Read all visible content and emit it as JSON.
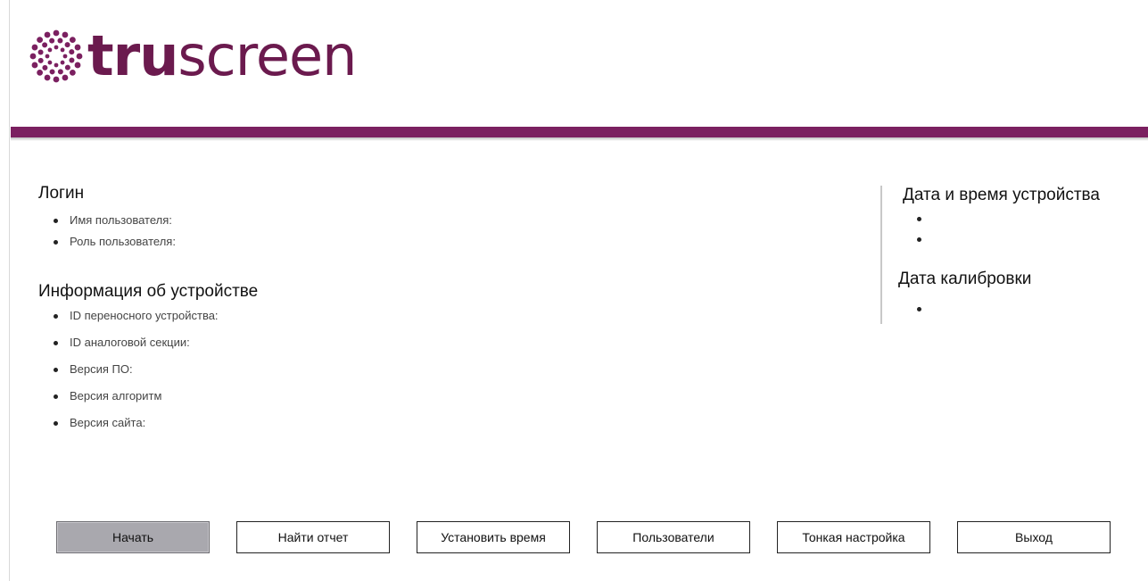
{
  "brand": {
    "logo_text_bold": "tru",
    "logo_text_thin": "screen",
    "accent_color": "#7b2060"
  },
  "login": {
    "title": "Логин",
    "items": [
      {
        "label": "Имя пользователя:"
      },
      {
        "label": "Роль пользователя:"
      }
    ]
  },
  "device_info": {
    "title": "Информация об устройстве",
    "items": [
      {
        "label": "ID переносного устройства:"
      },
      {
        "label": "ID аналоговой секции:"
      },
      {
        "label": "Версия ПО:"
      },
      {
        "label": "Версия алгоритм"
      },
      {
        "label": "Версия сайта:"
      }
    ]
  },
  "device_datetime": {
    "title": "Дата и время устройства"
  },
  "calibration": {
    "title": "Дата калибровки"
  },
  "buttons": {
    "start": "Начать",
    "find_report": "Найти отчет",
    "set_time": "Установить время",
    "users": "Пользователи",
    "fine_tuning": "Тонкая настройка",
    "exit": "Выход"
  }
}
